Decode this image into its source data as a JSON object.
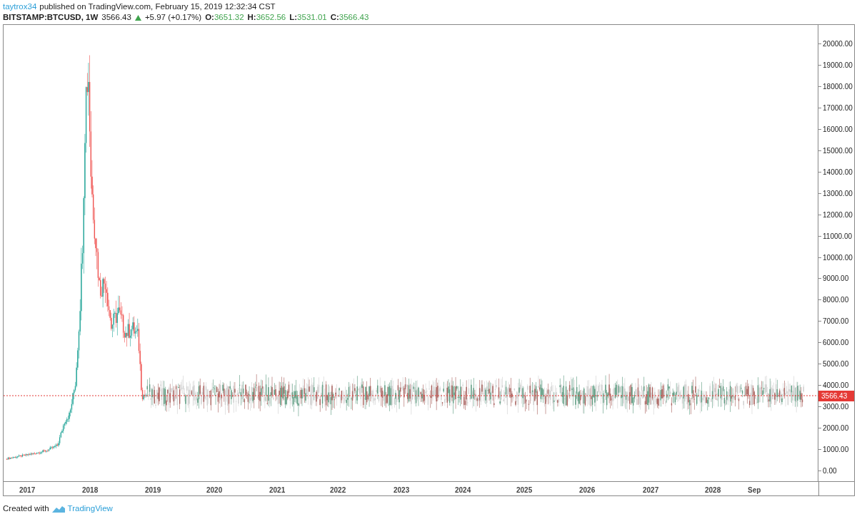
{
  "header": {
    "author": "taytrox34",
    "published": "published on TradingView.com, February 15, 2019 12:32:34 CST"
  },
  "symbol": {
    "name": "BITSTAMP:BTCUSD, 1W",
    "price": "3566.43",
    "rising": true,
    "change": "+5.97 (+0.17%)",
    "ohlc": [
      {
        "label": "O:",
        "value": "3651.32"
      },
      {
        "label": "H:",
        "value": "3652.56"
      },
      {
        "label": "L:",
        "value": "3531.01"
      },
      {
        "label": "C:",
        "value": "3566.43"
      }
    ]
  },
  "chart": {
    "y_axis_labels": [
      "20000.00",
      "19000.00",
      "18000.00",
      "17000.00",
      "16000.00",
      "15000.00",
      "14000.00",
      "13000.00",
      "12000.00",
      "11000.00",
      "10000.00",
      "9000.00",
      "8000.00",
      "7000.00",
      "6000.00",
      "5000.00",
      "4000.00",
      "3000.00",
      "2000.00",
      "1000.00",
      "0.00"
    ],
    "x_axis_labels": [
      "2017",
      "2018",
      "2019",
      "2020",
      "2021",
      "2022",
      "2023",
      "2024",
      "2025",
      "2026",
      "2027",
      "2028",
      "Sep"
    ],
    "last_price_label": "3566.43"
  },
  "footer": {
    "text": "Created with",
    "brand": "TradingView"
  }
}
